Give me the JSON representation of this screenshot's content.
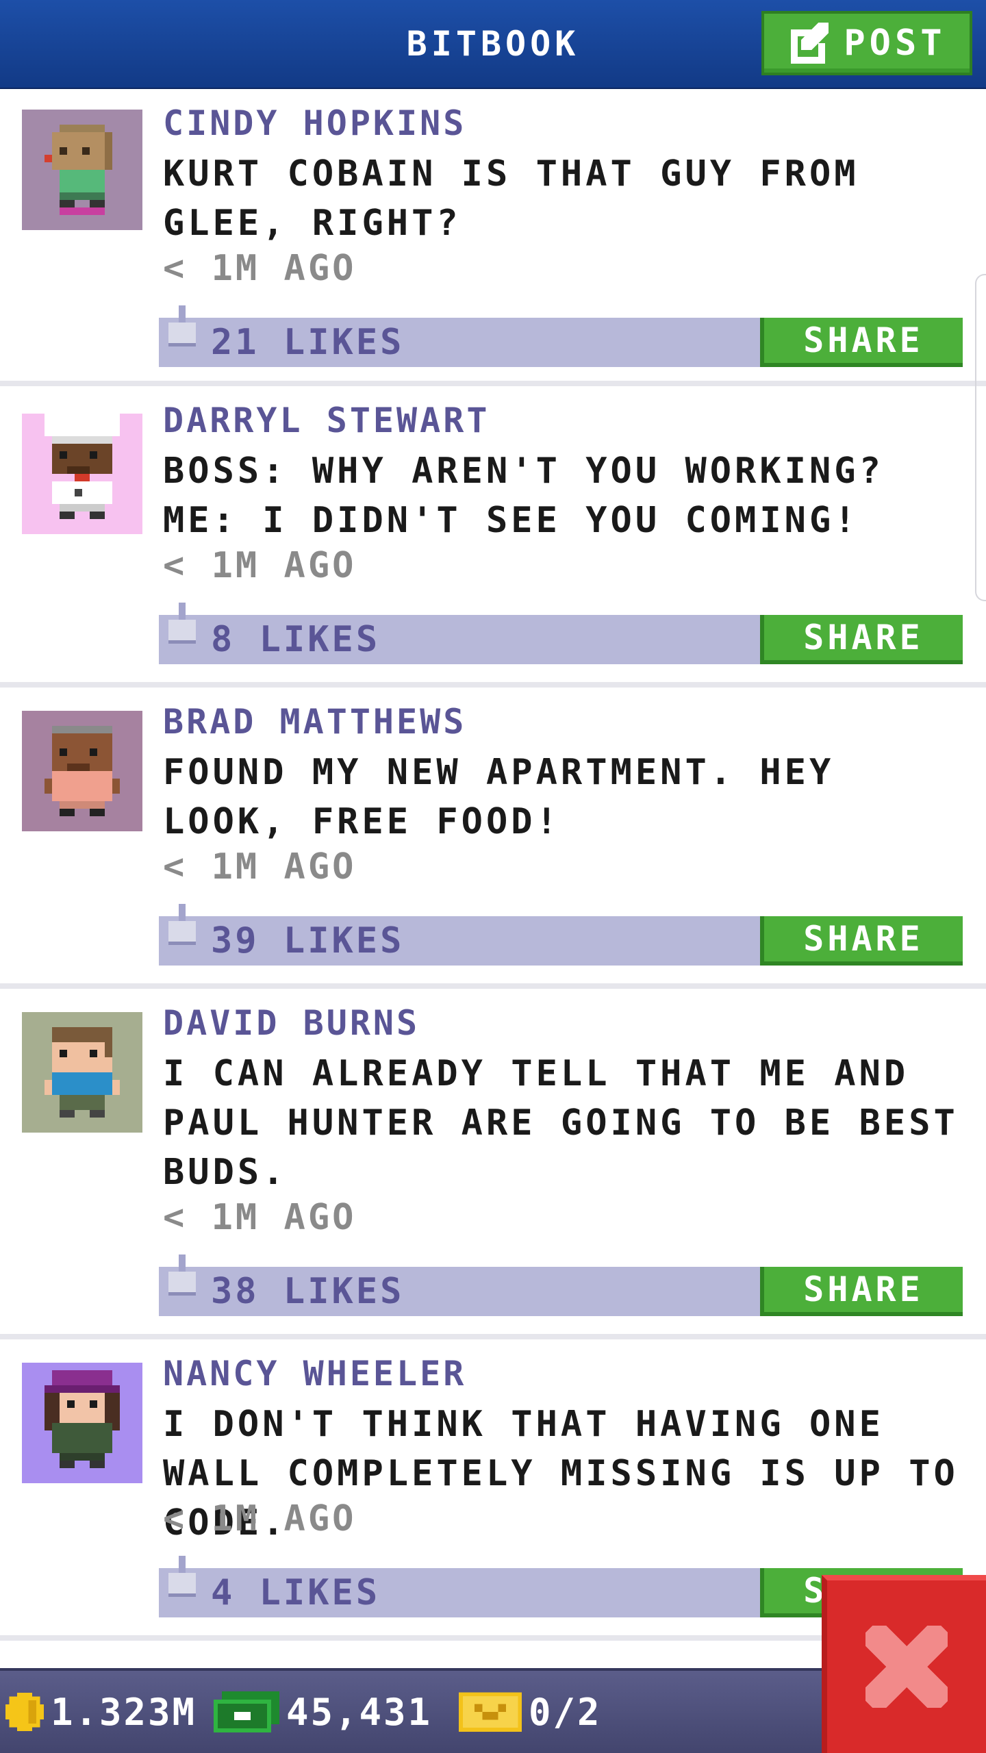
{
  "header": {
    "title": "BITBOOK",
    "post_label": "POST"
  },
  "posts": [
    {
      "author": "CINDY HOPKINS",
      "text": "KURT COBAIN IS THAT GUY FROM GLEE, RIGHT?",
      "time": "< 1M AGO",
      "likes": "21 LIKES",
      "share_label": "SHARE",
      "avatar_bg": "#a38aa9",
      "avatar_icon": "bitizen-green-shirt-icon"
    },
    {
      "author": "DARRYL STEWART",
      "text": "BOSS: WHY AREN'T YOU WORKING? ME: I DIDN'T SEE YOU COMING!",
      "time": "< 1M AGO",
      "likes": "8 LIKES",
      "share_label": "SHARE",
      "avatar_bg": "#f7c2f0",
      "avatar_icon": "bitizen-chef-icon"
    },
    {
      "author": "BRAD MATTHEWS",
      "text": "FOUND MY NEW APARTMENT. HEY LOOK, FREE FOOD!",
      "time": "< 1M AGO",
      "likes": "39 LIKES",
      "share_label": "SHARE",
      "avatar_bg": "#a682a0",
      "avatar_icon": "bitizen-pink-shirt-icon"
    },
    {
      "author": "DAVID BURNS",
      "text": "I CAN ALREADY TELL THAT ME AND PAUL HUNTER ARE GOING TO BE BEST BUDS.",
      "time": "< 1M AGO",
      "likes": "38 LIKES",
      "share_label": "SHARE",
      "avatar_bg": "#a6ae90",
      "avatar_icon": "bitizen-blue-shirt-icon"
    },
    {
      "author": "NANCY WHEELER",
      "text": "I DON'T THINK THAT HAVING ONE WALL COMPLETELY MISSING IS UP TO CODE.",
      "time": "< 1M AGO",
      "likes": "4 LIKES",
      "share_label": "SHARE",
      "avatar_bg": "#a98ef0",
      "avatar_icon": "bitizen-purple-hat-icon"
    }
  ],
  "status": {
    "coins": "1.323M",
    "bux": "45,431",
    "vip": "0/2"
  },
  "colors": {
    "header": "#1d4fa8",
    "share_green": "#4caf3a",
    "likes_bar": "#b7b8d9",
    "author_text": "#5a5596",
    "close_red": "#d92a2a"
  }
}
